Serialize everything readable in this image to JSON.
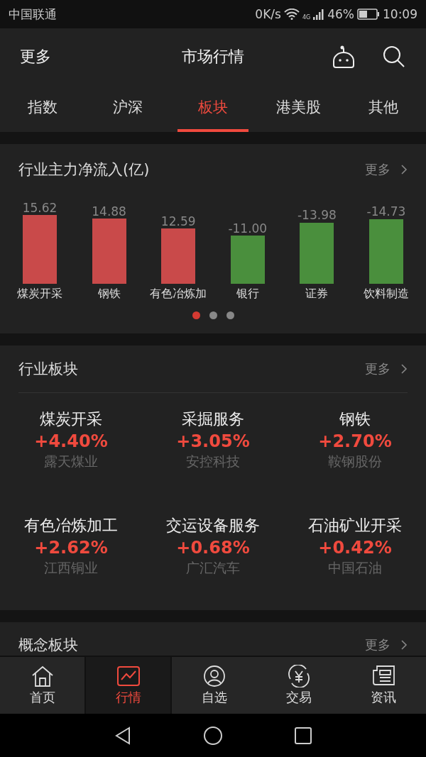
{
  "status_bar": {
    "carrier": "中国联通",
    "speed": "0K/s",
    "network": "4G",
    "battery": "46%",
    "time": "10:09"
  },
  "header": {
    "left": "更多",
    "title": "市场行情"
  },
  "tabs": [
    {
      "label": "指数",
      "selected": false
    },
    {
      "label": "沪深",
      "selected": false
    },
    {
      "label": "板块",
      "selected": true
    },
    {
      "label": "港美股",
      "selected": false
    },
    {
      "label": "其他",
      "selected": false
    }
  ],
  "flow_card": {
    "title": "行业主力净流入(亿)",
    "more": "更多",
    "bars": [
      {
        "value": "15.62",
        "name": "煤炭开采",
        "color": "#c94a4a"
      },
      {
        "value": "14.88",
        "name": "钢铁",
        "color": "#c94a4a"
      },
      {
        "value": "12.59",
        "name": "有色冶炼加",
        "color": "#c94a4a"
      },
      {
        "value": "-11.00",
        "name": "银行",
        "color": "#4a8f3d"
      },
      {
        "value": "-13.98",
        "name": "证券",
        "color": "#4a8f3d"
      },
      {
        "value": "-14.73",
        "name": "饮料制造",
        "color": "#4a8f3d"
      }
    ],
    "pages": [
      {
        "selected": true
      },
      {
        "selected": false
      },
      {
        "selected": false
      }
    ]
  },
  "industry_card": {
    "title": "行业板块",
    "more": "更多",
    "items": [
      {
        "name": "煤炭开采",
        "change": "+4.40%",
        "stock": "露天煤业"
      },
      {
        "name": "采掘服务",
        "change": "+3.05%",
        "stock": "安控科技"
      },
      {
        "name": "钢铁",
        "change": "+2.70%",
        "stock": "鞍钢股份"
      },
      {
        "name": "有色冶炼加工",
        "change": "+2.62%",
        "stock": "江西铜业"
      },
      {
        "name": "交运设备服务",
        "change": "+0.68%",
        "stock": "广汇汽车"
      },
      {
        "name": "石油矿业开采",
        "change": "+0.42%",
        "stock": "中国石油"
      }
    ]
  },
  "concept_card": {
    "title": "概念板块",
    "more": "更多"
  },
  "bottom_nav": [
    {
      "label": "首页",
      "selected": false
    },
    {
      "label": "行情",
      "selected": true
    },
    {
      "label": "自选",
      "selected": false
    },
    {
      "label": "交易",
      "selected": false
    },
    {
      "label": "资讯",
      "selected": false
    }
  ]
}
